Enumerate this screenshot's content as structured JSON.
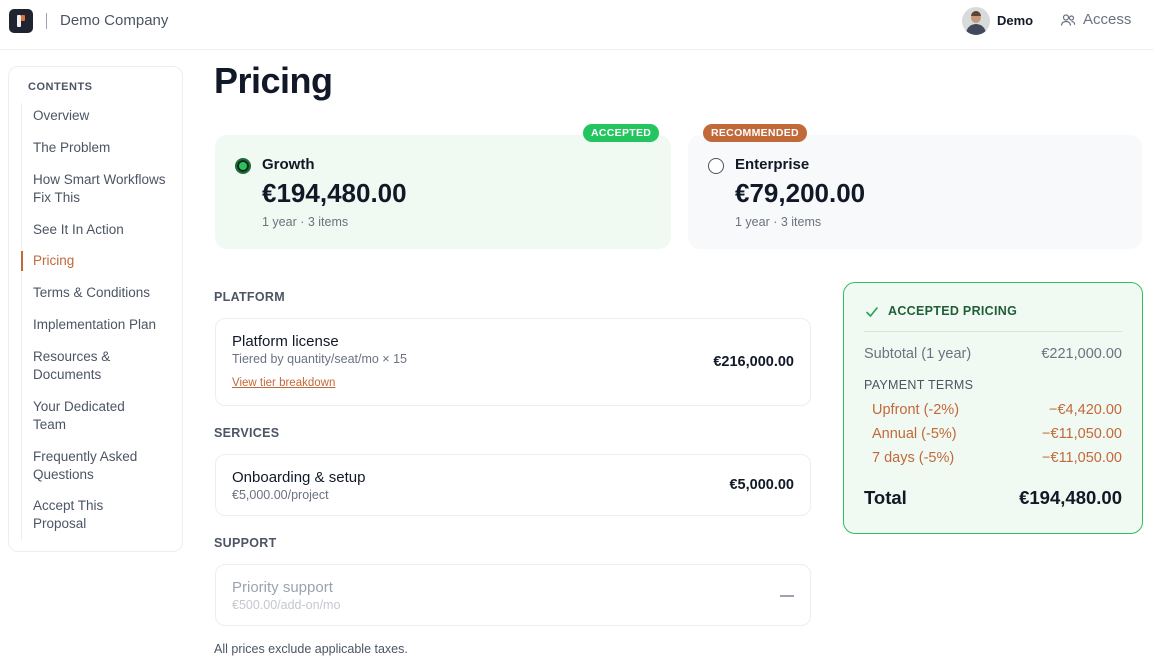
{
  "header": {
    "company": "Demo Company",
    "user_name": "Demo",
    "access_label": "Access"
  },
  "sidebar": {
    "title": "CONTENTS",
    "items": [
      {
        "label": "Overview"
      },
      {
        "label": "The Problem"
      },
      {
        "label": "How Smart Workflows Fix This"
      },
      {
        "label": "See It In Action"
      },
      {
        "label": "Pricing",
        "active": true
      },
      {
        "label": "Terms & Conditions"
      },
      {
        "label": "Implementation Plan"
      },
      {
        "label": "Resources & Documents"
      },
      {
        "label": "Your Dedicated Team"
      },
      {
        "label": "Frequently Asked Questions"
      },
      {
        "label": "Accept This Proposal"
      }
    ]
  },
  "main": {
    "title": "Pricing",
    "plans": [
      {
        "badge": "ACCEPTED",
        "name": "Growth",
        "price": "€194,480.00",
        "meta": "1 year · 3 items",
        "selected": true
      },
      {
        "badge": "RECOMMENDED",
        "name": "Enterprise",
        "price": "€79,200.00",
        "meta": "1 year · 3 items",
        "selected": false
      }
    ],
    "sections": [
      {
        "label": "PLATFORM",
        "items": [
          {
            "name": "Platform license",
            "sub": "Tiered by quantity/seat/mo × 15",
            "link": "View tier breakdown",
            "amount": "€216,000.00"
          }
        ]
      },
      {
        "label": "SERVICES",
        "items": [
          {
            "name": "Onboarding & setup",
            "sub": "€5,000.00/project",
            "amount": "€5,000.00"
          }
        ]
      },
      {
        "label": "SUPPORT",
        "items": [
          {
            "name": "Priority support",
            "sub": "€500.00/add-on/mo",
            "amount": "—",
            "disabled": true
          }
        ]
      }
    ],
    "footnote": "All prices exclude applicable taxes."
  },
  "summary": {
    "title": "ACCEPTED PRICING",
    "subtotal_label": "Subtotal (1 year)",
    "subtotal_value": "€221,000.00",
    "terms_label": "PAYMENT TERMS",
    "terms": [
      {
        "label": "Upfront (-2%)",
        "value": "−€4,420.00"
      },
      {
        "label": "Annual (-5%)",
        "value": "−€11,050.00"
      },
      {
        "label": "7 days (-5%)",
        "value": "−€11,050.00"
      }
    ],
    "total_label": "Total",
    "total_value": "€194,480.00"
  },
  "colors": {
    "accent": "#c2693a",
    "success": "#22c55e",
    "success_bg": "#f0faf2"
  }
}
